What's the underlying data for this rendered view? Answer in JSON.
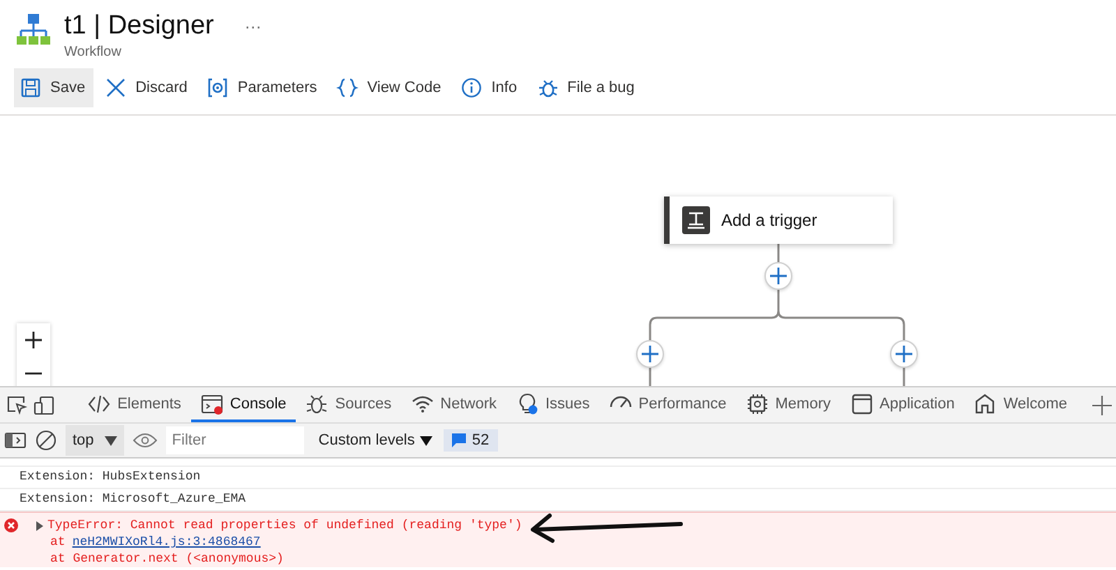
{
  "header": {
    "title": "t1 | Designer",
    "more": "···",
    "subtitle": "Workflow"
  },
  "toolbar": [
    {
      "label": "Save",
      "kind": "save",
      "highlighted": true
    },
    {
      "label": "Discard",
      "kind": "discard",
      "highlighted": false
    },
    {
      "label": "Parameters",
      "kind": "parameters",
      "highlighted": false
    },
    {
      "label": "View Code",
      "kind": "code",
      "highlighted": false
    },
    {
      "label": "Info",
      "kind": "info",
      "highlighted": false
    },
    {
      "label": "File a bug",
      "kind": "bug",
      "highlighted": false
    }
  ],
  "canvas": {
    "trigger": {
      "label": "Add a trigger"
    }
  },
  "devtools": {
    "tabs": [
      {
        "label": "Elements",
        "kind": "elements",
        "selected": false
      },
      {
        "label": "Console",
        "kind": "console",
        "selected": true
      },
      {
        "label": "Sources",
        "kind": "sources",
        "selected": false
      },
      {
        "label": "Network",
        "kind": "network",
        "selected": false
      },
      {
        "label": "Issues",
        "kind": "issues",
        "selected": false
      },
      {
        "label": "Performance",
        "kind": "performance",
        "selected": false
      },
      {
        "label": "Memory",
        "kind": "memory",
        "selected": false
      },
      {
        "label": "Application",
        "kind": "application",
        "selected": false
      },
      {
        "label": "Welcome",
        "kind": "welcome",
        "selected": false
      }
    ],
    "toolbar": {
      "context": "top",
      "filter_placeholder": "Filter",
      "levels": "Custom levels",
      "message_count": "52"
    },
    "console": [
      {
        "kind": "log",
        "text": "Extension: HubsExtension"
      },
      {
        "kind": "log",
        "text": "Extension: Microsoft_Azure_EMA"
      },
      {
        "kind": "error",
        "text": "TypeError: Cannot read properties of undefined (reading 'type')",
        "expanded": false,
        "stack": [
          {
            "text": "at",
            "link": "neH2MWIXoRl4.js:3:4868467"
          },
          {
            "text": "at Generator.next (<anonymous>)"
          }
        ]
      }
    ]
  }
}
